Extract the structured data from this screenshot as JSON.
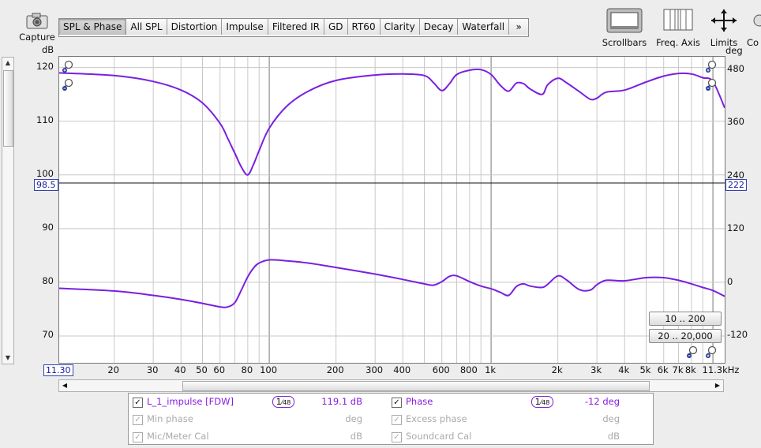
{
  "toolbar": {
    "capture_label": "Capture",
    "tabs": [
      "SPL & Phase",
      "All SPL",
      "Distortion",
      "Impulse",
      "Filtered IR",
      "GD",
      "RT60",
      "Clarity",
      "Decay",
      "Waterfall",
      "»"
    ],
    "active_tab": "SPL & Phase",
    "right_tools": [
      "Scrollbars",
      "Freq. Axis",
      "Limits",
      "Co"
    ]
  },
  "axes": {
    "left_unit": "dB",
    "right_unit": "deg",
    "left_ticks": [
      "120",
      "110",
      "100",
      "90",
      "80",
      "70"
    ],
    "right_ticks": [
      "480",
      "360",
      "240",
      "120",
      "0",
      "-120"
    ],
    "x_ticks": [
      "20",
      "30",
      "40",
      "50",
      "60",
      "80",
      "100",
      "200",
      "300",
      "400",
      "600",
      "800",
      "1k",
      "2k",
      "3k",
      "4k",
      "5k",
      "6k",
      "7k",
      "8k",
      "11.3kHz"
    ],
    "x_start_box": "11.30",
    "cursor_left_value": "98.5",
    "cursor_right_value": "222",
    "range_buttons": [
      "10 .. 200",
      "20 .. 20,000"
    ]
  },
  "chart_data": {
    "type": "line",
    "x_scale": "log",
    "xlim": [
      11.3,
      11300
    ],
    "ylim_left": [
      65,
      122
    ],
    "ylim_right": [
      -180,
      510
    ],
    "series": [
      {
        "name": "L_1_impulse [FDW]",
        "axis": "left",
        "color": "#7a1fe0",
        "x": [
          11.3,
          20,
          30,
          40,
          50,
          60,
          65,
          70,
          75,
          80,
          85,
          90,
          100,
          120,
          150,
          200,
          300,
          400,
          500,
          550,
          600,
          650,
          700,
          800,
          900,
          1000,
          1100,
          1200,
          1300,
          1400,
          1500,
          1700,
          1800,
          2000,
          2200,
          2500,
          2800,
          3000,
          3300,
          4000,
          5000,
          6000,
          7000,
          8000,
          9000,
          10000,
          11300
        ],
        "y": [
          119,
          118.5,
          117.4,
          115.8,
          113.4,
          109.6,
          106.8,
          104,
          101.4,
          100,
          102,
          104.5,
          108.7,
          112.8,
          115.6,
          117.6,
          118.6,
          118.8,
          118.5,
          117.2,
          115.7,
          117,
          118.7,
          119.5,
          119.6,
          118.7,
          116.7,
          115.6,
          117.1,
          117,
          116,
          115,
          116.8,
          118,
          117.1,
          115.5,
          114.1,
          114.3,
          115.4,
          115.8,
          117.3,
          118.4,
          118.9,
          118.8,
          118.1,
          117.4,
          112.5
        ]
      },
      {
        "name": "Phase",
        "axis": "right",
        "color": "#7a1fe0",
        "x": [
          11.3,
          20,
          30,
          40,
          50,
          60,
          65,
          70,
          75,
          80,
          85,
          90,
          100,
          120,
          150,
          200,
          300,
          400,
          500,
          550,
          600,
          650,
          700,
          800,
          900,
          1000,
          1100,
          1200,
          1300,
          1400,
          1500,
          1700,
          1800,
          2000,
          2200,
          2500,
          2800,
          3000,
          3300,
          4000,
          5000,
          6000,
          7000,
          8000,
          9000,
          10000,
          11300
        ],
        "y": [
          -12,
          -18,
          -28,
          -37,
          -46,
          -54,
          -54,
          -44,
          -15,
          14,
          34,
          45,
          52,
          50,
          45,
          35,
          20,
          8,
          -2,
          -5,
          3,
          15,
          16,
          3,
          -7,
          -13,
          -21,
          -28,
          -8,
          -2,
          -7,
          -10,
          -3,
          16,
          6,
          -15,
          -16,
          -4,
          6,
          5,
          12,
          12,
          6,
          -2,
          -10,
          -17,
          -30
        ]
      }
    ]
  },
  "legend": {
    "rows": [
      {
        "checked": true,
        "enabled": true,
        "name": "L_1_impulse [FDW]",
        "smoothing": "1/48",
        "value": "119.1 dB"
      },
      {
        "checked": true,
        "enabled": false,
        "name": "Min phase",
        "smoothing": "",
        "value": "deg"
      },
      {
        "checked": true,
        "enabled": false,
        "name": "Mic/Meter Cal",
        "smoothing": "",
        "value": "dB"
      }
    ],
    "rows_right": [
      {
        "checked": true,
        "enabled": true,
        "name": "Phase",
        "smoothing": "1/48",
        "value": "-12 deg"
      },
      {
        "checked": true,
        "enabled": false,
        "name": "Excess phase",
        "smoothing": "",
        "value": "deg"
      },
      {
        "checked": true,
        "enabled": false,
        "name": "Soundcard Cal",
        "smoothing": "",
        "value": "dB"
      }
    ]
  },
  "icons": {
    "capture": "camera-icon",
    "scrollbars": "window-scrollbars-icon",
    "freq_axis": "frequency-axis-icon",
    "limits": "limits-arrows-icon",
    "zoom_in": "zoom-in-icon",
    "zoom_out": "zoom-out-icon"
  }
}
